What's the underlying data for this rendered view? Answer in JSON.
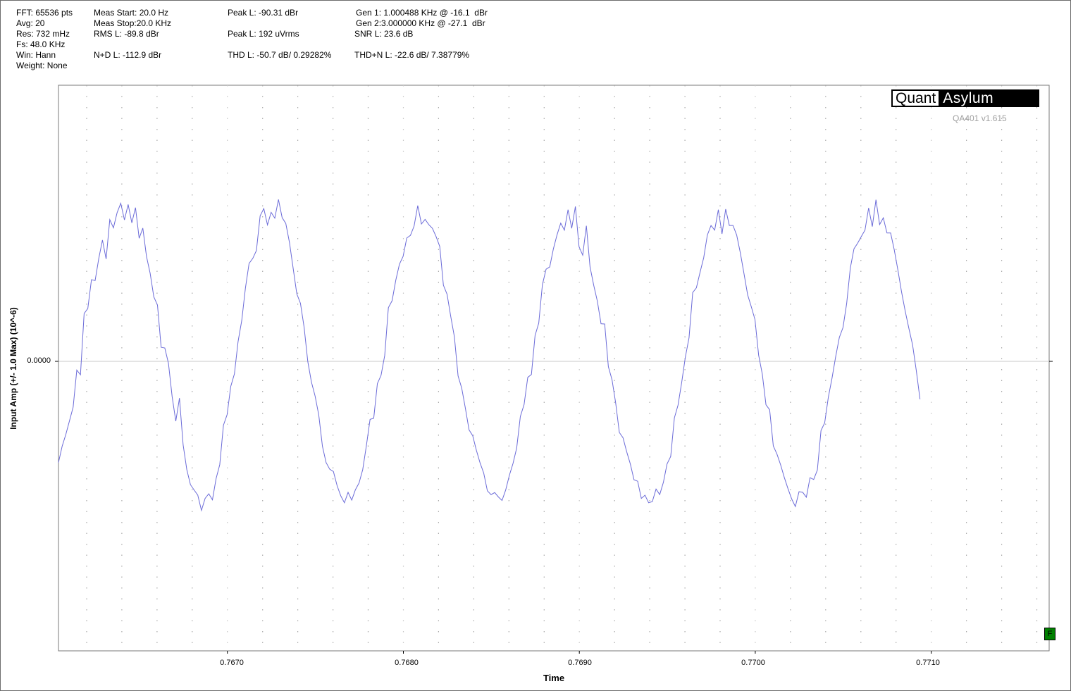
{
  "stats": {
    "fft": "FFT: 65536 pts",
    "avg": "Avg: 20",
    "res": "Res: 732 mHz",
    "fs": "Fs: 48.0 KHz",
    "win": "Win: Hann",
    "weight": "Weight: None",
    "meas_start": "Meas Start: 20.0 Hz",
    "meas_stop": "Meas Stop:20.0 KHz",
    "rms": "RMS L: -89.8 dBr",
    "nd": "N+D L: -112.9 dBr",
    "peak_dbr": "Peak L: -90.31 dBr",
    "peak_uv": "Peak L: 192 uVrms",
    "thd": "THD L: -50.7 dB/ 0.29282%",
    "gen1": "Gen 1: 1.000488 KHz @ -16.1  dBr",
    "gen2": "Gen 2:3.000000 KHz @ -27.1  dBr",
    "snr": "SNR L: 23.6 dB",
    "thdn": "THD+N L: -22.6 dB/ 7.38779%"
  },
  "logo": {
    "part1": "Quant",
    "part2": "Asylum"
  },
  "version": "QA401 v1.615",
  "badge": "F",
  "chart_data": {
    "type": "line",
    "xlabel": "Time",
    "ylabel": "Input Amp (+/- 1.0 Max) (10^-6)",
    "x_ticks": [
      "0.7670",
      "0.7680",
      "0.7690",
      "0.7700",
      "0.7710"
    ],
    "y_ticks": [
      "0.0000"
    ],
    "xlim": [
      0.76604,
      0.77167
    ],
    "grid": true,
    "line_color": "#6b6bd8",
    "series": [
      {
        "sample_interval": 2.08333e-05,
        "x_start": 0.76604,
        "values": [
          -0.347,
          -0.291,
          -0.251,
          -0.204,
          -0.157,
          -0.03,
          -0.046,
          0.164,
          0.181,
          0.28,
          0.277,
          0.353,
          0.416,
          0.351,
          0.486,
          0.458,
          0.51,
          0.542,
          0.485,
          0.538,
          0.475,
          0.527,
          0.422,
          0.457,
          0.36,
          0.302,
          0.221,
          0.193,
          0.048,
          0.046,
          -0.007,
          -0.121,
          -0.205,
          -0.126,
          -0.286,
          -0.371,
          -0.423,
          -0.441,
          -0.459,
          -0.511,
          -0.47,
          -0.454,
          -0.475,
          -0.402,
          -0.354,
          -0.219,
          -0.183,
          -0.086,
          -0.043,
          0.068,
          0.14,
          0.251,
          0.336,
          0.353,
          0.38,
          0.499,
          0.524,
          0.468,
          0.511,
          0.491,
          0.555,
          0.493,
          0.473,
          0.408,
          0.32,
          0.232,
          0.199,
          0.117,
          0.0,
          -0.071,
          -0.119,
          -0.184,
          -0.291,
          -0.347,
          -0.37,
          -0.378,
          -0.426,
          -0.461,
          -0.485,
          -0.449,
          -0.476,
          -0.44,
          -0.417,
          -0.371,
          -0.289,
          -0.199,
          -0.195,
          -0.076,
          -0.048,
          0.02,
          0.184,
          0.208,
          0.278,
          0.333,
          0.36,
          0.423,
          0.432,
          0.464,
          0.534,
          0.471,
          0.487,
          0.469,
          0.456,
          0.428,
          0.394,
          0.261,
          0.23,
          0.154,
          0.084,
          -0.05,
          -0.092,
          -0.161,
          -0.235,
          -0.255,
          -0.305,
          -0.348,
          -0.383,
          -0.444,
          -0.457,
          -0.45,
          -0.465,
          -0.477,
          -0.441,
          -0.391,
          -0.35,
          -0.297,
          -0.189,
          -0.148,
          -0.055,
          -0.045,
          0.089,
          0.131,
          0.263,
          0.316,
          0.324,
          0.386,
          0.434,
          0.474,
          0.45,
          0.52,
          0.456,
          0.531,
          0.393,
          0.364,
          0.465,
          0.324,
          0.261,
          0.206,
          0.129,
          0.128,
          -0.018,
          -0.063,
          -0.143,
          -0.244,
          -0.262,
          -0.31,
          -0.352,
          -0.406,
          -0.411,
          -0.47,
          -0.459,
          -0.485,
          -0.481,
          -0.438,
          -0.457,
          -0.415,
          -0.352,
          -0.326,
          -0.194,
          -0.15,
          -0.072,
          0.015,
          0.081,
          0.236,
          0.252,
          0.305,
          0.355,
          0.433,
          0.466,
          0.45,
          0.52,
          0.437,
          0.522,
          0.466,
          0.466,
          0.433,
          0.372,
          0.301,
          0.228,
          0.187,
          0.143,
          0.021,
          -0.044,
          -0.149,
          -0.166,
          -0.29,
          -0.318,
          -0.355,
          -0.398,
          -0.437,
          -0.472,
          -0.498,
          -0.447,
          -0.449,
          -0.466,
          -0.399,
          -0.405,
          -0.373,
          -0.237,
          -0.211,
          -0.123,
          -0.058,
          0.016,
          0.082,
          0.116,
          0.198,
          0.32,
          0.386,
          0.405,
          0.428,
          0.45,
          0.526,
          0.462,
          0.554,
          0.469,
          0.492,
          0.44,
          0.44,
          0.382,
          0.312,
          0.237,
          0.171,
          0.112,
          0.056,
          -0.031,
          -0.13
        ]
      }
    ]
  }
}
